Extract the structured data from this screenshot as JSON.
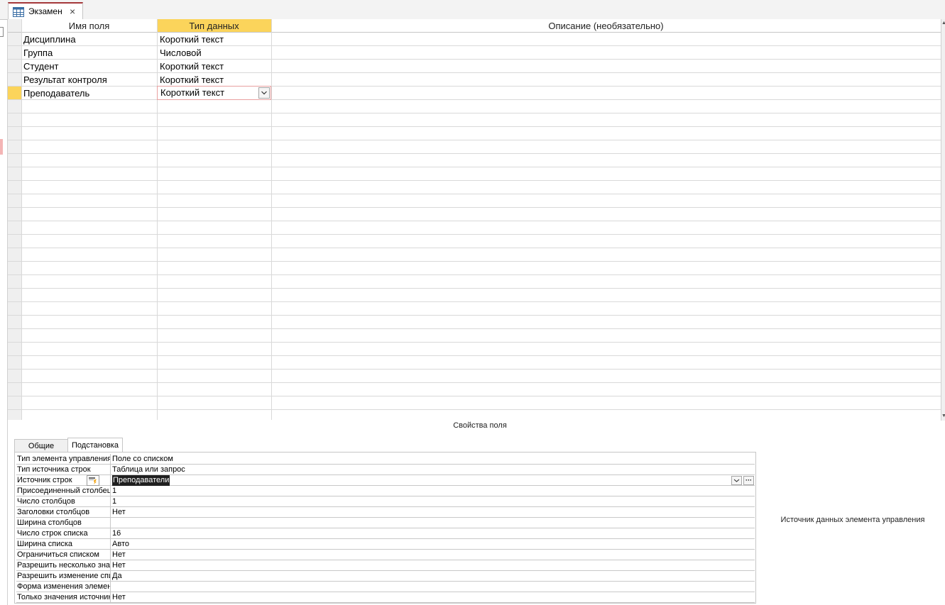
{
  "document_tab": {
    "title": "Экзамен",
    "close_symbol": "×"
  },
  "grid": {
    "headers": {
      "field_name": "Имя поля",
      "data_type": "Тип данных",
      "description": "Описание (необязательно)"
    },
    "rows": [
      {
        "field_name": "Дисциплина",
        "data_type": "Короткий текст"
      },
      {
        "field_name": "Группа",
        "data_type": "Числовой"
      },
      {
        "field_name": "Студент",
        "data_type": "Короткий текст"
      },
      {
        "field_name": "Результат контроля",
        "data_type": "Короткий текст"
      },
      {
        "field_name": "Преподаватель",
        "data_type": "Короткий текст"
      }
    ]
  },
  "properties": {
    "caption": "Свойства поля",
    "tabs": {
      "general": "Общие",
      "lookup": "Подстановка"
    },
    "rows": [
      {
        "label": "Тип элемента управления",
        "value": "Поле со списком"
      },
      {
        "label": "Тип источника строк",
        "value": "Таблица или запрос"
      },
      {
        "label": "Источник строк",
        "value": "Преподаватели"
      },
      {
        "label": "Присоединенный столбец",
        "value": "1"
      },
      {
        "label": "Число столбцов",
        "value": "1"
      },
      {
        "label": "Заголовки столбцов",
        "value": "Нет"
      },
      {
        "label": "Ширина столбцов",
        "value": ""
      },
      {
        "label": "Число строк списка",
        "value": "16"
      },
      {
        "label": "Ширина списка",
        "value": "Авто"
      },
      {
        "label": "Ограничиться списком",
        "value": "Нет"
      },
      {
        "label": "Разрешить несколько значений",
        "value": "Нет"
      },
      {
        "label": "Разрешить изменение списка значений",
        "value": "Да"
      },
      {
        "label": "Форма изменения элементов списка",
        "value": ""
      },
      {
        "label": "Только значения источника строк",
        "value": "Нет"
      }
    ],
    "builder_button_symbol": "···",
    "help_text": "Источник данных элемента управления"
  },
  "colors": {
    "accent": "#fbd45b",
    "tab_accent": "#a4373a",
    "selection": "#1f1f1f"
  },
  "icons": [
    "table-icon",
    "close-icon",
    "chevron-down-icon",
    "build-icon",
    "builder-wizard-icon"
  ]
}
